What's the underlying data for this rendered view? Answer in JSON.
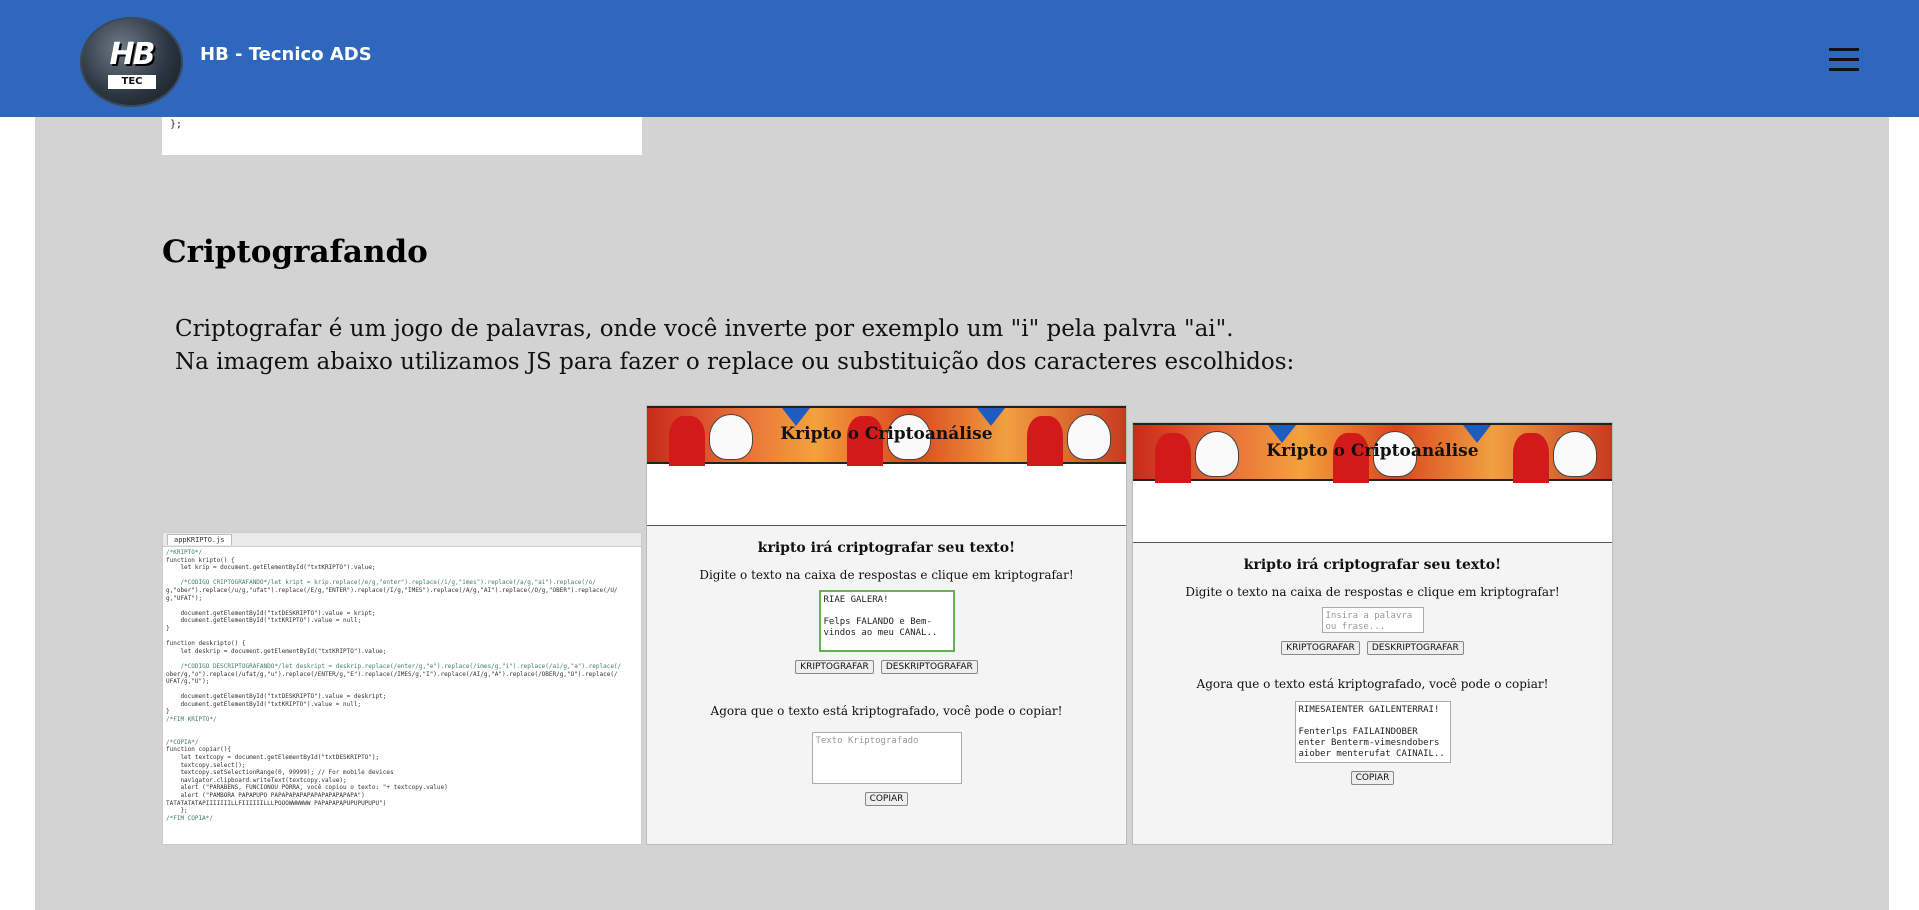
{
  "header": {
    "logo_text": "HB",
    "logo_sub": "TEC",
    "site_title": "HB - Tecnico ADS"
  },
  "code_tail": "};",
  "section": {
    "title": "Criptografando",
    "desc_line1": "Criptografar é um jogo de palavras, onde você inverte por exemplo um \"i\" pela palvra \"ai\".",
    "desc_line2": "Na imagem abaixo utilizamos JS para fazer o replace ou substituição dos caracteres escolhidos:"
  },
  "code_image": {
    "tab": "appKRIPTO.js",
    "lines": [
      "/*KRIPTO*/",
      "function kripto() {",
      "    let krip = document.getElementById(\"txtKRIPTO\").value;",
      "",
      "    /*CODIGO CRIPTOGRAFANDO*/let kript = krip.replace(/e/g,\"enter\").replace(/i/g,\"imes\").replace(/a/g,\"ai\").replace(/o/",
      "g,\"ober\").replace(/u/g,\"ufat\").replace(/E/g,\"ENTER\").replace(/I/g,\"IMES\").replace(/A/g,\"AI\").replace(/O/g,\"OBER\").replace(/U/",
      "g,\"UFAT\");",
      "",
      "    document.getElementById(\"txtDESKRIPTO\").value = kript;",
      "    document.getElementById(\"txtKRIPTO\").value = null;",
      "}",
      "",
      "function deskripto() {",
      "    let deskrip = document.getElementById(\"txtKRIPTO\").value;",
      "",
      "    /*CODIGO DESCRIPTOGRAFANDO*/let deskript = deskrip.replace(/enter/g,\"e\").replace(/imes/g,\"i\").replace(/ai/g,\"a\").replace(/",
      "ober/g,\"o\").replace(/ufat/g,\"u\").replace(/ENTER/g,\"E\").replace(/IMES/g,\"I\").replace(/AI/g,\"A\").replace(/OBER/g,\"O\").replace(/",
      "UFAT/g,\"U\");",
      "",
      "    document.getElementById(\"txtDESKRIPTO\").value = deskript;",
      "    document.getElementById(\"txtKRIPTO\").value = null;",
      "}",
      "/*FIM KRIPTO*/",
      "",
      "",
      "/*COPIA*/",
      "function copiar(){",
      "    let textcopy = document.getElementById(\"txtDESKRIPTO\");",
      "    textcopy.select();",
      "    textcopy.setSelectionRange(0, 99999); // For mobile devices",
      "    navigator.clipboard.writeText(textcopy.value);",
      "    alert (\"PARABENS, FUNCIONOU PORRA, você copiou o texto: \"+ textcopy.value)",
      "    alert (\"PAMBORA PAPAPUPO PAPAPAPAPAPAPAPAPAPAPAPA\")",
      "TATATATATAPIIIIIIILLFIIIIIILLLPOOOWWWWWW PAPAPAPAPUPUPUPUPU\")",
      "    };",
      "/*FIM COPIA*/"
    ]
  },
  "app1": {
    "banner_title": "Kripto o Criptoanálise",
    "heading": "kripto irá criptografar seu texto!",
    "instruction": "Digite o texto na caixa de respostas e clique em kriptografar!",
    "input_value": "RIAE GALERA!\n\nFelps FALANDO e Bem-vindos ao meu CANAL..",
    "btn_kripto": "KRIPTOGRAFAR",
    "btn_deskripto": "DESKRIPTOGRAFAR",
    "copy_text": "Agora que o texto está kriptografado, você pode o copiar!",
    "output_placeholder": "Texto Kriptografado",
    "btn_copy": "COPIAR"
  },
  "app2": {
    "banner_title": "Kripto o Criptoanálise",
    "heading": "kripto irá criptografar seu texto!",
    "instruction": "Digite o texto na caixa de respostas e clique em kriptografar!",
    "input_placeholder": "Insira a palavra ou frase...",
    "btn_kripto": "KRIPTOGRAFAR",
    "btn_deskripto": "DESKRIPTOGRAFAR",
    "copy_text": "Agora que o texto está kriptografado, você pode o copiar!",
    "output_value": "RIMESAIENTER GAILENTERRAI!\n\nFenterlps FAILAINDOBER enter Benterm-vimesndobers aiober menterufat CAINAIL..",
    "btn_copy": "COPIAR"
  }
}
